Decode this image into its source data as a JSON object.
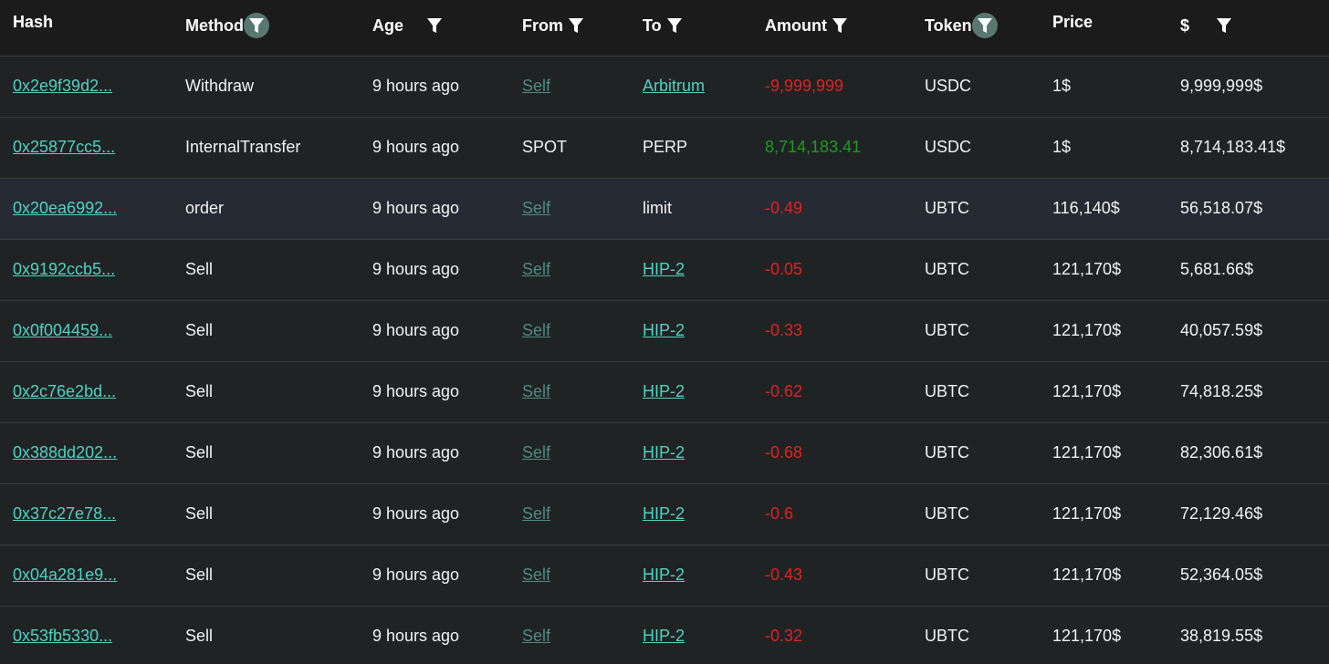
{
  "colors": {
    "background": "#202324",
    "header_background": "#1b1b1b",
    "link": "#50d2c1",
    "self_link": "#4f8a80",
    "negative": "#e12121",
    "positive": "#1f9a1f",
    "active_filter": "#58786f"
  },
  "headers": {
    "hash": "Hash",
    "method": "Method",
    "age": "Age",
    "from": "From",
    "to": "To",
    "amount": "Amount",
    "token": "Token",
    "price": "Price",
    "usd": "$"
  },
  "icons": {
    "filter": "filter-funnel-icon"
  },
  "rows": [
    {
      "hash": "0x2e9f39d2...",
      "method": "Withdraw",
      "age": "9 hours ago",
      "from": "Self",
      "to": "Arbitrum",
      "amount": "-9,999,999",
      "token": "USDC",
      "price": "1$",
      "usd": "9,999,999$"
    },
    {
      "hash": "0x25877cc5...",
      "method": "InternalTransfer",
      "age": "9 hours ago",
      "from": "SPOT",
      "to": "PERP",
      "amount": "8,714,183.41",
      "token": "USDC",
      "price": "1$",
      "usd": "8,714,183.41$"
    },
    {
      "hash": "0x20ea6992...",
      "method": "order",
      "age": "9 hours ago",
      "from": "Self",
      "to": "limit",
      "amount": "-0.49",
      "token": "UBTC",
      "price": "116,140$",
      "usd": "56,518.07$"
    },
    {
      "hash": "0x9192ccb5...",
      "method": "Sell",
      "age": "9 hours ago",
      "from": "Self",
      "to": "HIP-2",
      "amount": "-0.05",
      "token": "UBTC",
      "price": "121,170$",
      "usd": "5,681.66$"
    },
    {
      "hash": "0x0f004459...",
      "method": "Sell",
      "age": "9 hours ago",
      "from": "Self",
      "to": "HIP-2",
      "amount": "-0.33",
      "token": "UBTC",
      "price": "121,170$",
      "usd": "40,057.59$"
    },
    {
      "hash": "0x2c76e2bd...",
      "method": "Sell",
      "age": "9 hours ago",
      "from": "Self",
      "to": "HIP-2",
      "amount": "-0.62",
      "token": "UBTC",
      "price": "121,170$",
      "usd": "74,818.25$"
    },
    {
      "hash": "0x388dd202...",
      "method": "Sell",
      "age": "9 hours ago",
      "from": "Self",
      "to": "HIP-2",
      "amount": "-0.68",
      "token": "UBTC",
      "price": "121,170$",
      "usd": "82,306.61$"
    },
    {
      "hash": "0x37c27e78...",
      "method": "Sell",
      "age": "9 hours ago",
      "from": "Self",
      "to": "HIP-2",
      "amount": "-0.6",
      "token": "UBTC",
      "price": "121,170$",
      "usd": "72,129.46$"
    },
    {
      "hash": "0x04a281e9...",
      "method": "Sell",
      "age": "9 hours ago",
      "from": "Self",
      "to": "HIP-2",
      "amount": "-0.43",
      "token": "UBTC",
      "price": "121,170$",
      "usd": "52,364.05$"
    },
    {
      "hash": "0x53fb5330...",
      "method": "Sell",
      "age": "9 hours ago",
      "from": "Self",
      "to": "HIP-2",
      "amount": "-0.32",
      "token": "UBTC",
      "price": "121,170$",
      "usd": "38,819.55$"
    }
  ]
}
